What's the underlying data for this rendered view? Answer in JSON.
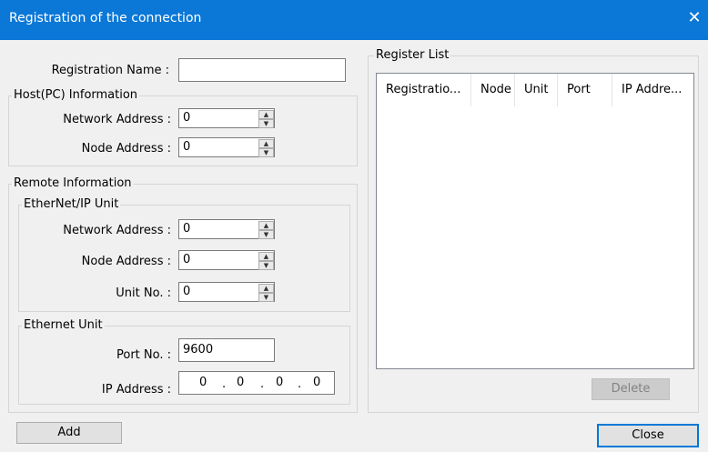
{
  "window": {
    "title": "Registration of the connection",
    "close_glyph": "✕"
  },
  "registration": {
    "label": "Registration Name :",
    "value": ""
  },
  "host": {
    "legend": "Host(PC) Information",
    "network_label": "Network Address :",
    "network_value": "0",
    "node_label": "Node Address :",
    "node_value": "0"
  },
  "remote": {
    "legend": "Remote Information",
    "ethernetip": {
      "legend": "EtherNet/IP Unit",
      "network_label": "Network Address :",
      "network_value": "0",
      "node_label": "Node Address :",
      "node_value": "0",
      "unit_label": "Unit No. :",
      "unit_value": "0"
    },
    "ethernet": {
      "legend": "Ethernet Unit",
      "port_label": "Port No. :",
      "port_value": "9600",
      "ip_label": "IP Address :",
      "ip_octets": [
        "0",
        "0",
        "0",
        "0"
      ],
      "ip_separator": "."
    }
  },
  "register_list": {
    "legend": "Register List",
    "columns": [
      "Registratio...",
      "Node",
      "Unit",
      "Port",
      "IP Addre..."
    ],
    "rows": []
  },
  "buttons": {
    "add": "Add",
    "delete": "Delete",
    "close": "Close"
  },
  "icons": {
    "spin_up": "▲",
    "spin_down": "▼"
  }
}
